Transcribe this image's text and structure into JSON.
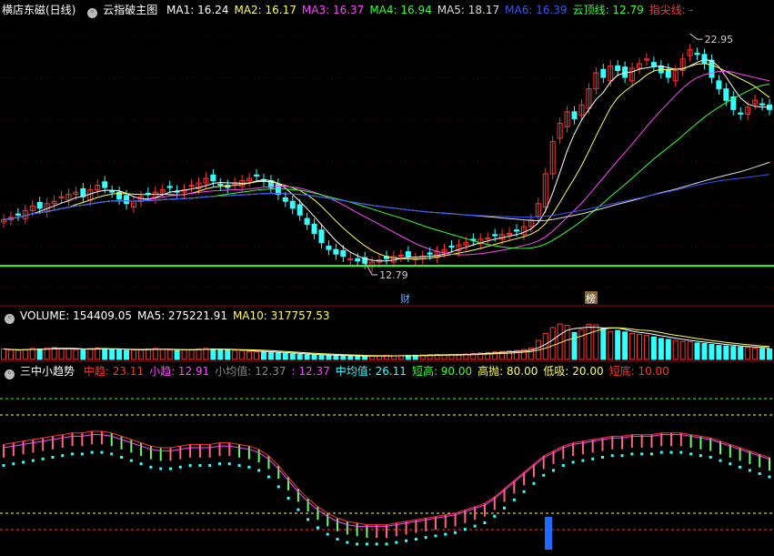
{
  "header": {
    "stock_name": "横店东磁(日线)",
    "main_indicator": "云指破主图",
    "items": [
      {
        "text": "MA1: 16.24",
        "color": "#ffffff"
      },
      {
        "text": "MA2: 16.17",
        "color": "#ffff55"
      },
      {
        "text": "MA3: 16.37",
        "color": "#ff44ff"
      },
      {
        "text": "MA4: 16.94",
        "color": "#33ff33"
      },
      {
        "text": "MA5: 18.17",
        "color": "#dddddd"
      },
      {
        "text": "MA6: 16.39",
        "color": "#3355ff"
      },
      {
        "text": "云顶线: 12.79",
        "color": "#33ff33"
      },
      {
        "text": "指尖线: -",
        "color": "#ff3333"
      }
    ]
  },
  "volume_header": {
    "items": [
      {
        "text": "VOLUME: 154409.05",
        "color": "#ffffff"
      },
      {
        "text": "MA5: 275221.91",
        "color": "#ffffff"
      },
      {
        "text": "MA10: 317757.53",
        "color": "#ffff55"
      }
    ]
  },
  "trend_header": {
    "name": "三中小趋势",
    "items": [
      {
        "text": "中趋: 23.11",
        "color": "#ff3333"
      },
      {
        "text": "小趋: 12.91",
        "color": "#ff44ff"
      },
      {
        "text": "小均值: 12.37",
        "color": "#888888"
      },
      {
        "text": ": 12.37",
        "color": "#ff44ff"
      },
      {
        "text": "中均值: 26.11",
        "color": "#33ffff"
      },
      {
        "text": "短高: 90.00",
        "color": "#33ff33"
      },
      {
        "text": "高抛: 80.00",
        "color": "#ffff55"
      },
      {
        "text": "低吸: 20.00",
        "color": "#ffff55"
      },
      {
        "text": "短底: 10.00",
        "color": "#ff3333"
      }
    ]
  },
  "chart_data": [
    {
      "type": "candlestick",
      "panel": "price",
      "annotations": [
        {
          "label": "22.95",
          "kind": "high"
        },
        {
          "label": "12.79",
          "kind": "low"
        },
        {
          "label": "财",
          "kind": "marker"
        },
        {
          "label": "榜",
          "kind": "marker"
        }
      ],
      "cloud_line": 12.79,
      "close": [
        14.8,
        14.9,
        15.0,
        15.2,
        15.4,
        15.3,
        15.5,
        15.6,
        15.8,
        15.9,
        16.0,
        15.8,
        16.1,
        16.3,
        16.2,
        16.0,
        15.7,
        15.5,
        15.6,
        15.8,
        15.9,
        16.0,
        16.1,
        16.2,
        16.0,
        16.1,
        16.3,
        16.4,
        16.6,
        16.5,
        16.3,
        16.2,
        16.4,
        16.5,
        16.6,
        16.7,
        16.5,
        16.2,
        15.9,
        15.6,
        15.3,
        15.0,
        14.6,
        14.2,
        13.8,
        13.5,
        13.3,
        13.2,
        13.1,
        13.0,
        12.9,
        12.95,
        13.05,
        13.1,
        13.2,
        13.25,
        13.2,
        13.1,
        13.2,
        13.3,
        13.4,
        13.5,
        13.6,
        13.7,
        13.8,
        13.9,
        13.95,
        14.0,
        14.1,
        14.15,
        14.2,
        14.3,
        14.5,
        14.8,
        15.5,
        16.8,
        18.2,
        19.0,
        19.5,
        19.2,
        19.8,
        20.5,
        21.2,
        21.0,
        21.5,
        21.3,
        21.0,
        21.4,
        21.6,
        21.8,
        21.5,
        21.2,
        21.0,
        21.3,
        21.8,
        22.2,
        22.0,
        21.6,
        21.0,
        20.5,
        20.0,
        19.6,
        19.4,
        19.7,
        20.0,
        19.8,
        19.6
      ]
    },
    {
      "type": "bar",
      "panel": "volume",
      "values": [
        210,
        190,
        180,
        200,
        220,
        210,
        230,
        240,
        220,
        210,
        200,
        190,
        210,
        230,
        220,
        200,
        190,
        180,
        190,
        200,
        210,
        220,
        200,
        190,
        180,
        190,
        200,
        210,
        220,
        210,
        200,
        190,
        180,
        170,
        160,
        150,
        150,
        140,
        130,
        120,
        110,
        100,
        95,
        90,
        85,
        80,
        75,
        80,
        70,
        65,
        60,
        70,
        75,
        80,
        70,
        75,
        80,
        85,
        90,
        95,
        100,
        90,
        95,
        100,
        110,
        120,
        130,
        140,
        150,
        160,
        170,
        180,
        200,
        230,
        380,
        520,
        640,
        710,
        680,
        540,
        600,
        700,
        690,
        620,
        560,
        580,
        550,
        520,
        500,
        480,
        450,
        420,
        400,
        380,
        360,
        350,
        330,
        320,
        300,
        280,
        270,
        260,
        250,
        240,
        230,
        220,
        210
      ],
      "ma5_label": "MA5",
      "ma10_label": "MA10"
    },
    {
      "type": "line",
      "panel": "trend",
      "levels": [
        90,
        80,
        20,
        10
      ],
      "series": [
        {
          "name": "中趋",
          "values": [
            62,
            63,
            64,
            65,
            66,
            67,
            68,
            69,
            69,
            70,
            70,
            69,
            67,
            65,
            63,
            61,
            60,
            60,
            61,
            62,
            62,
            62,
            63,
            63,
            62,
            61,
            59,
            55,
            49,
            42,
            35,
            29,
            24,
            20,
            17,
            15,
            14,
            13,
            13,
            13,
            14,
            15,
            16,
            17,
            18,
            19,
            20,
            22,
            24,
            26,
            30,
            35,
            40,
            45,
            50,
            55,
            58,
            61,
            63,
            64,
            65,
            66,
            67,
            67,
            68,
            68,
            68,
            69,
            69,
            69,
            68,
            67,
            66,
            64,
            62,
            60,
            58,
            56,
            54
          ]
        },
        {
          "name": "小趋",
          "values": [
            60,
            61,
            62,
            63,
            64,
            65,
            66,
            67,
            67,
            68,
            68,
            67,
            65,
            63,
            61,
            59,
            58,
            58,
            59,
            60,
            60,
            60,
            61,
            61,
            60,
            59,
            57,
            53,
            47,
            40,
            33,
            27,
            22,
            18,
            15,
            13,
            12,
            12,
            12,
            12,
            13,
            14,
            15,
            16,
            17,
            18,
            19,
            21,
            23,
            25,
            29,
            34,
            39,
            44,
            49,
            54,
            57,
            60,
            62,
            63,
            64,
            65,
            66,
            66,
            67,
            67,
            67,
            68,
            68,
            68,
            67,
            66,
            65,
            63,
            61,
            59,
            57,
            55,
            53
          ]
        }
      ]
    }
  ]
}
